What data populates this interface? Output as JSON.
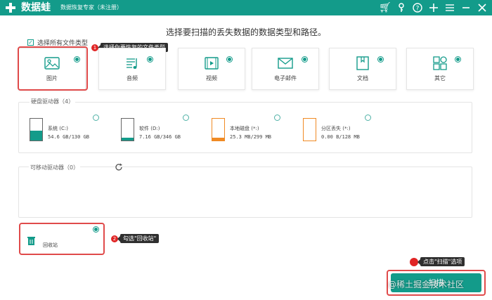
{
  "app": {
    "name": "数据蛙",
    "subtitle": "数据恢复专家（未注册）"
  },
  "window_icons": [
    "cart-icon",
    "key-icon",
    "help-icon",
    "plus-icon",
    "menu-icon",
    "minimize-icon",
    "close-icon"
  ],
  "heading": "选择要扫描的丢失数据的数据类型和路径。",
  "select_all": {
    "label": "选择所有文件类型",
    "checked": true
  },
  "tooltip_step1": "选择你要恢复的文件类型",
  "file_types": [
    {
      "label": "图片",
      "icon": "image-icon",
      "selected": true
    },
    {
      "label": "音频",
      "icon": "audio-icon",
      "selected": true
    },
    {
      "label": "视频",
      "icon": "video-icon",
      "selected": true
    },
    {
      "label": "电子邮件",
      "icon": "email-icon",
      "selected": true
    },
    {
      "label": "文档",
      "icon": "document-icon",
      "selected": true
    },
    {
      "label": "其它",
      "icon": "other-icon",
      "selected": true
    }
  ],
  "hard_drives": {
    "title": "硬盘驱动器（4）",
    "items": [
      {
        "name": "系统 (C:)",
        "size": "54.6 GB/130 GB",
        "fill": 0.42,
        "color": "#139b8a",
        "selected": false
      },
      {
        "name": "软件 (D:)",
        "size": "7.16 GB/346 GB",
        "fill": 0.02,
        "color": "#139b8a",
        "selected": false
      },
      {
        "name": "本地磁盘 (*:)",
        "size": "25.3 MB/299 MB",
        "fill": 0.08,
        "color": "#f08a24",
        "selected": false
      },
      {
        "name": "分区丢失 (*:)",
        "size": "0.00  B/128 MB",
        "fill": 0.0,
        "color": "#f08a24",
        "selected": false
      }
    ]
  },
  "removable": {
    "title": "可移动驱动器（0）"
  },
  "recycle_bin": {
    "label": "回收站",
    "selected": true
  },
  "tooltip_step2": "勾选\"回收站\"",
  "tooltip_step3": "点击\"扫描\"选项",
  "scan_button": "扫描",
  "watermark": "@稀土掘金技术社区",
  "colors": {
    "accent": "#139b8a",
    "highlight": "#e04a4a"
  }
}
